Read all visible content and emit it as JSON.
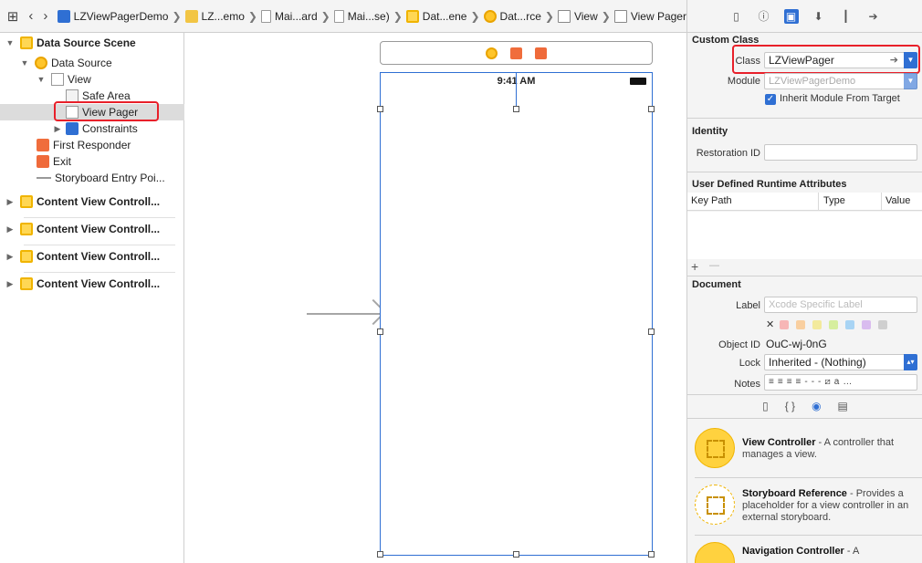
{
  "breadcrumb": [
    {
      "label": "LZViewPagerDemo",
      "icon": "project-icon"
    },
    {
      "label": "LZ...emo",
      "icon": "folder-icon"
    },
    {
      "label": "Mai...ard",
      "icon": "storyboard-file-icon"
    },
    {
      "label": "Mai...se)",
      "icon": "storyboard-file-icon"
    },
    {
      "label": "Dat...ene",
      "icon": "scene-icon"
    },
    {
      "label": "Dat...rce",
      "icon": "view-controller-icon"
    },
    {
      "label": "View",
      "icon": "view-icon"
    },
    {
      "label": "View Pager",
      "icon": "view-icon"
    }
  ],
  "outline": {
    "scene": "Data Source Scene",
    "data_source": "Data Source",
    "view": "View",
    "safe_area": "Safe Area",
    "view_pager": "View Pager",
    "constraints": "Constraints",
    "first_responder": "First Responder",
    "exit": "Exit",
    "entry_point": "Storyboard Entry Poi...",
    "content_scenes": [
      "Content View Controll...",
      "Content View Controll...",
      "Content View Controll...",
      "Content View Controll..."
    ]
  },
  "canvas": {
    "status_time": "9:41 AM"
  },
  "inspector": {
    "custom_class": {
      "title": "Custom Class",
      "class_label": "Class",
      "class_value": "LZViewPager",
      "module_label": "Module",
      "module_placeholder": "LZViewPagerDemo",
      "inherit_label": "Inherit Module From Target"
    },
    "identity": {
      "title": "Identity",
      "restoration_label": "Restoration ID"
    },
    "runtime": {
      "title": "User Defined Runtime Attributes",
      "col_key": "Key Path",
      "col_type": "Type",
      "col_value": "Value",
      "add": "+",
      "remove": "—"
    },
    "document": {
      "title": "Document",
      "label_label": "Label",
      "label_placeholder": "Xcode Specific Label",
      "clear": "✕",
      "object_id_label": "Object ID",
      "object_id_value": "OuC-wj-0nG",
      "lock_label": "Lock",
      "lock_value": "Inherited - (Nothing)",
      "notes_label": "Notes",
      "swatches": [
        "#f7b6b6",
        "#f9cfa0",
        "#f3ea9c",
        "#d6ee9d",
        "#a8d4f4",
        "#d9bcef",
        "#cfcfcf"
      ]
    },
    "library": [
      {
        "title": "View Controller",
        "desc": " - A controller that manages a view."
      },
      {
        "title": "Storyboard Reference",
        "desc": " - Provides a placeholder for a view controller in an external storyboard."
      },
      {
        "title": "Navigation Controller",
        "desc": " - A"
      }
    ]
  },
  "colors": {
    "accent": "#2f6fd3",
    "highlight": "#e8202a"
  }
}
